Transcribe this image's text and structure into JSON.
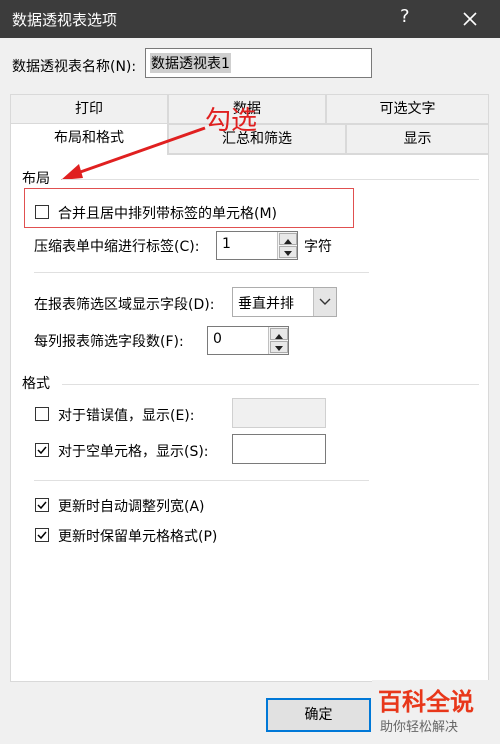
{
  "titlebar": {
    "title": "数据透视表选项",
    "help": "?",
    "close_icon": "close-icon"
  },
  "name_field": {
    "label": "数据透视表名称(N):",
    "value": "数据透视表1"
  },
  "tabs_top": [
    {
      "label": "打印"
    },
    {
      "label": "数据"
    },
    {
      "label": "可选文字"
    }
  ],
  "tabs_bottom": [
    {
      "label": "布局和格式",
      "active": true
    },
    {
      "label": "汇总和筛选"
    },
    {
      "label": "显示"
    }
  ],
  "annotation": {
    "text": "勾选",
    "color": "#e02020"
  },
  "layout": {
    "section_title": "布局",
    "merge_center": {
      "label": "合并且居中排列带标签的单元格(M)",
      "checked": false
    },
    "indent": {
      "label": "压缩表单中缩进行标签(C):",
      "value": "1",
      "unit": "字符"
    },
    "report_filter_area": {
      "label": "在报表筛选区域显示字段(D):",
      "value": "垂直并排"
    },
    "fields_per_column": {
      "label": "每列报表筛选字段数(F):",
      "value": "0"
    }
  },
  "format": {
    "section_title": "格式",
    "error_values": {
      "label": "对于错误值，显示(E):",
      "checked": false,
      "value": ""
    },
    "empty_cells": {
      "label": "对于空单元格，显示(S):",
      "checked": true,
      "value": ""
    },
    "autofit": {
      "label": "更新时自动调整列宽(A)",
      "checked": true
    },
    "preserve_format": {
      "label": "更新时保留单元格格式(P)",
      "checked": true
    }
  },
  "footer": {
    "ok_label": "确定"
  },
  "watermark": {
    "brand": "百科全说",
    "slogan": "助你轻松解决"
  }
}
